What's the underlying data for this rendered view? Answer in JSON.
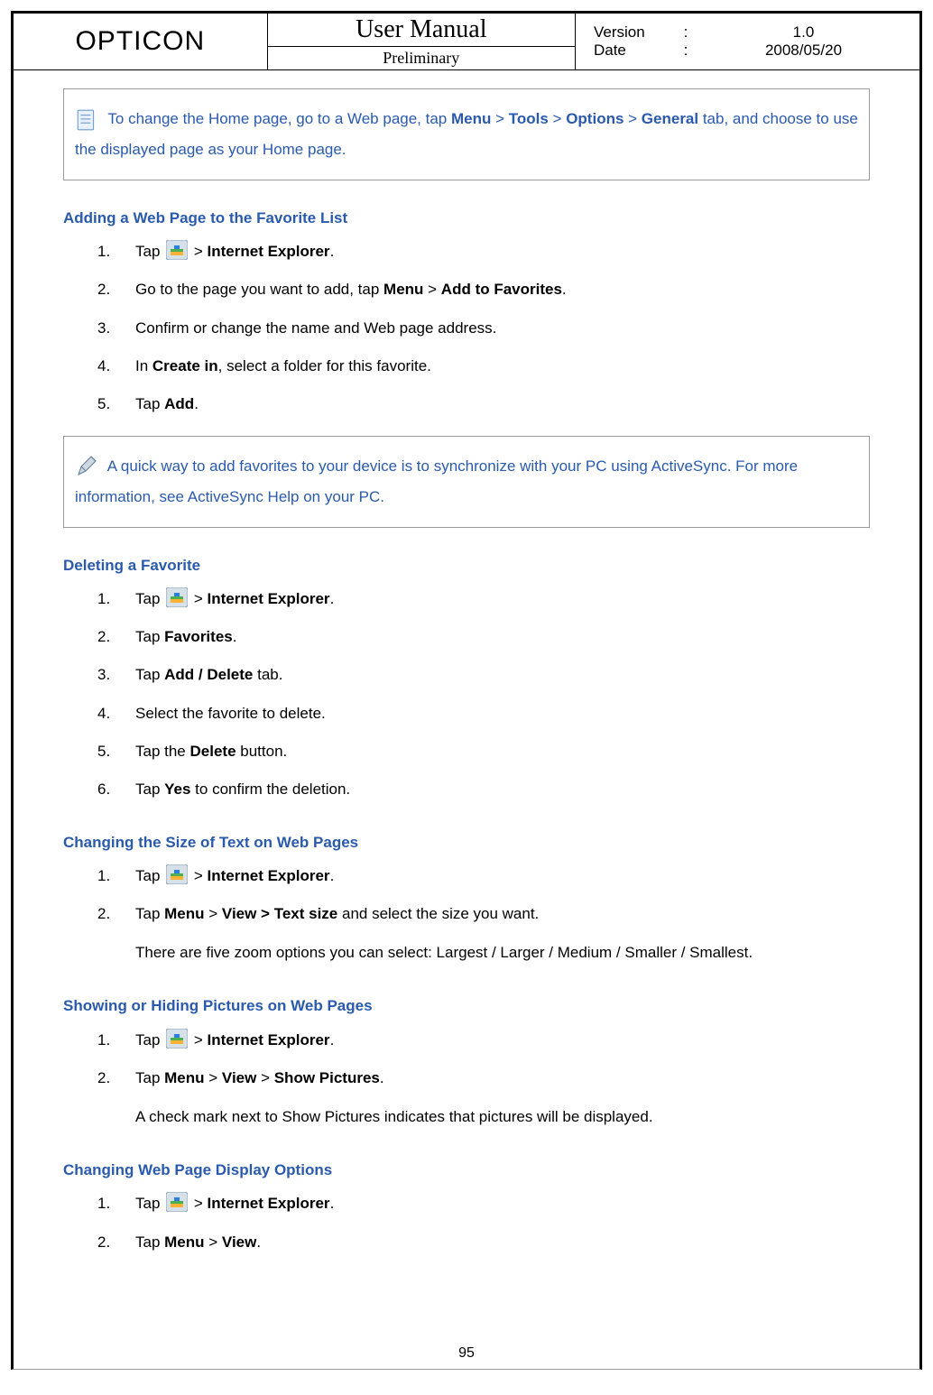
{
  "header": {
    "brand": "OPTICON",
    "title": "User Manual",
    "subtitle": "Preliminary",
    "version_label": "Version",
    "version_value": "1.0",
    "date_label": "Date",
    "date_value": "2008/05/20",
    "colon": ":"
  },
  "note1": {
    "p1a": " To change the Home page, go to a Web page, tap ",
    "p1b": "Menu",
    "p1c": " > ",
    "p1d": "Tools",
    "p1e": " > ",
    "p1f": "Options",
    "p1g": " > ",
    "p2a": "General",
    "p2b": " tab, and choose to use the displayed page as your Home page."
  },
  "sec1": {
    "heading": "Adding a Web Page to the Favorite List",
    "s1a": "Tap ",
    "s1b": " > ",
    "s1c": "Internet Explorer",
    "s1d": ".",
    "s2a": "Go to the page you want to add, tap ",
    "s2b": "Menu",
    "s2c": " > ",
    "s2d": "Add to Favorites",
    "s2e": ".",
    "s3": "Confirm or change the name and Web page address.",
    "s4a": "In ",
    "s4b": "Create in",
    "s4c": ", select a folder for this favorite.",
    "s5a": "Tap ",
    "s5b": "Add",
    "s5c": "."
  },
  "note2": {
    "p1": " A quick way to add favorites to your device is to synchronize with your PC using ActiveSync. For more information, see ActiveSync Help on your PC."
  },
  "sec2": {
    "heading": "Deleting a Favorite",
    "s1a": "Tap ",
    "s1b": " > ",
    "s1c": "Internet Explorer",
    "s1d": ".",
    "s2a": "Tap ",
    "s2b": "Favorites",
    "s2c": ".",
    "s3a": "Tap ",
    "s3b": "Add / Delete",
    "s3c": " tab.",
    "s4": "Select the favorite to delete.",
    "s5a": "Tap the ",
    "s5b": "Delete",
    "s5c": " button.",
    "s6a": "Tap ",
    "s6b": "Yes",
    "s6c": " to confirm the deletion."
  },
  "sec3": {
    "heading": "Changing the Size of Text on Web Pages",
    "s1a": "Tap ",
    "s1b": " > ",
    "s1c": "Internet Explorer",
    "s1d": ".",
    "s2a": "Tap ",
    "s2b": "Menu",
    "s2c": " > ",
    "s2d": "View > Text size",
    "s2e": " and select the size you want.",
    "s2cont": "There are five zoom options you can select: Largest / Larger / Medium / Smaller / Smallest."
  },
  "sec4": {
    "heading": "Showing or Hiding Pictures on Web Pages",
    "s1a": "Tap ",
    "s1b": " > ",
    "s1c": "Internet Explorer",
    "s1d": ".",
    "s2a": "Tap ",
    "s2b": "Menu",
    "s2c": " > ",
    "s2d": "View",
    "s2e": " > ",
    "s2f": "Show Pictures",
    "s2g": ".",
    "s2cont": "A check mark next to Show Pictures indicates that pictures will be displayed."
  },
  "sec5": {
    "heading": "Changing Web Page Display Options",
    "s1a": "Tap ",
    "s1b": " > ",
    "s1c": "Internet Explorer",
    "s1d": ".",
    "s2a": "Tap ",
    "s2b": "Menu",
    "s2c": " > ",
    "s2d": "View",
    "s2e": "."
  },
  "nums": {
    "n1": "1.",
    "n2": "2.",
    "n3": "3.",
    "n4": "4.",
    "n5": "5.",
    "n6": "6."
  },
  "page_number": "95"
}
